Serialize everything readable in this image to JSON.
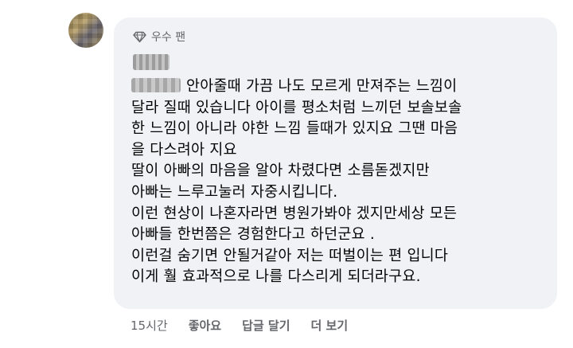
{
  "comment": {
    "badge_label": "우수 팬",
    "badge_icon": "diamond-icon",
    "lines": [
      "안아줄때 가끔 나도 모르게 만져주는 느낌이",
      "달라 질때 있습니다 아이를 평소처럼 느끼던 보솔보솔",
      "한 느낌이 아니라 야한 느낌 들때가 있지요 그땐 마음",
      "을 다스려아 지요",
      "딸이 아빠의 마음을 알아 차렸다면 소름돋겠지만",
      "아빠는 느루고눌러 자중시킵니다.",
      "이런 현상이 나혼자라면 병원가봐야 겠지만세상 모든",
      "아빠들 한번쯤은 경험한다고 하던군요 .",
      "이런걸 숨기면 안될거같아 저는 떠벌이는 편 입니다",
      "이게 훨 효과적으로 나를 다스리게 되더라구요."
    ]
  },
  "actions": {
    "time": "15시간",
    "like": "좋아요",
    "reply": "답글 달기",
    "more": "더 보기"
  },
  "colors": {
    "bubble_bg": "#f0f2f5",
    "text": "#050505",
    "secondary_text": "#65676b"
  }
}
